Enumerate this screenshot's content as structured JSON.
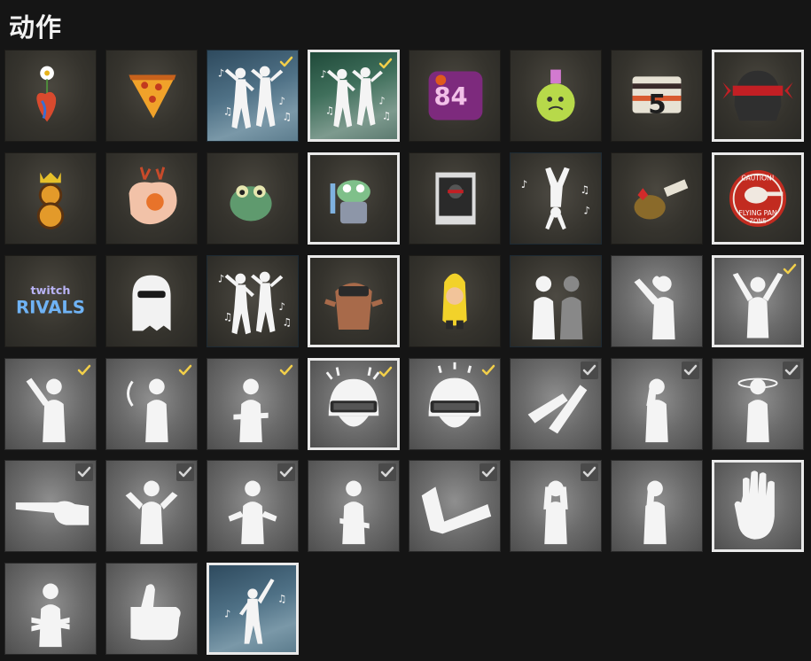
{
  "header": {
    "title": "动作"
  },
  "colors": {
    "check_gold": "#f2cf4a",
    "check_grey": "#d7d7d7",
    "selected_border": "#e9e9e9"
  },
  "rows": [
    [
      {
        "icon": "flower-heart-sticker-icon",
        "kind": "sticker",
        "selected": false,
        "check": ""
      },
      {
        "icon": "pizza-slice-sticker-icon",
        "kind": "sticker",
        "selected": false,
        "check": ""
      },
      {
        "icon": "dance-duo-emote-icon",
        "kind": "dance",
        "selected": false,
        "check": "gold"
      },
      {
        "icon": "dance-duo-emote-icon",
        "kind": "dance-green",
        "selected": true,
        "check": "gold"
      },
      {
        "icon": "graffiti-sticker-icon",
        "kind": "sticker",
        "selected": false,
        "check": ""
      },
      {
        "icon": "poison-potion-sticker-icon",
        "kind": "sticker",
        "selected": false,
        "check": ""
      },
      {
        "icon": "five-sticker-icon",
        "kind": "sticker",
        "selected": false,
        "check": ""
      },
      {
        "icon": "helmet-red-visor-sticker-icon",
        "kind": "sticker",
        "selected": true,
        "check": ""
      }
    ],
    [
      {
        "icon": "crowned-eight-sticker-icon",
        "kind": "sticker",
        "selected": false,
        "check": ""
      },
      {
        "icon": "reindeer-chicken-sticker-icon",
        "kind": "sticker",
        "selected": false,
        "check": ""
      },
      {
        "icon": "frog-sticker-icon",
        "kind": "sticker",
        "selected": false,
        "check": ""
      },
      {
        "icon": "frog-knight-sticker-icon",
        "kind": "sticker",
        "selected": true,
        "check": ""
      },
      {
        "icon": "wanted-poster-sticker-icon",
        "kind": "sticker",
        "selected": false,
        "check": ""
      },
      {
        "icon": "handstand-dance-emote-icon",
        "kind": "dance-dark",
        "selected": false,
        "check": ""
      },
      {
        "icon": "grenade-tag-sticker-icon",
        "kind": "sticker",
        "selected": false,
        "check": ""
      },
      {
        "icon": "flying-pan-zone-sticker-icon",
        "kind": "sticker",
        "selected": true,
        "check": ""
      }
    ],
    [
      {
        "icon": "twitch-rivals-sticker-icon",
        "kind": "sticker",
        "selected": false,
        "check": ""
      },
      {
        "icon": "ghost-sunglasses-sticker-icon",
        "kind": "sticker",
        "selected": false,
        "check": ""
      },
      {
        "icon": "dance-duo-emote-icon",
        "kind": "dance-dark",
        "selected": false,
        "check": ""
      },
      {
        "icon": "otter-vr-sticker-icon",
        "kind": "sticker",
        "selected": true,
        "check": ""
      },
      {
        "icon": "banana-character-sticker-icon",
        "kind": "sticker",
        "selected": false,
        "check": ""
      },
      {
        "icon": "push-duo-emote-icon",
        "kind": "dance-dark",
        "selected": false,
        "check": ""
      },
      {
        "icon": "heart-hands-emote-icon",
        "kind": "emote",
        "selected": false,
        "check": ""
      },
      {
        "icon": "surrender-emote-icon",
        "kind": "emote",
        "selected": true,
        "check": "gold"
      }
    ],
    [
      {
        "icon": "wave-emote-icon",
        "kind": "emote",
        "selected": false,
        "check": "gold"
      },
      {
        "icon": "head-turn-emote-icon",
        "kind": "emote",
        "selected": false,
        "check": "gold"
      },
      {
        "icon": "throat-cut-emote-icon",
        "kind": "emote",
        "selected": false,
        "check": "gold"
      },
      {
        "icon": "helmet-angry-emote-icon",
        "kind": "emote",
        "selected": true,
        "check": "gold"
      },
      {
        "icon": "helmet-laugh-emote-icon",
        "kind": "emote",
        "selected": false,
        "check": "gold"
      },
      {
        "icon": "clap-emote-icon",
        "kind": "emote",
        "selected": false,
        "check": "grey"
      },
      {
        "icon": "facepalm-emote-icon",
        "kind": "emote",
        "selected": false,
        "check": "grey"
      },
      {
        "icon": "dizzy-emote-icon",
        "kind": "emote",
        "selected": false,
        "check": "grey"
      }
    ],
    [
      {
        "icon": "point-emote-icon",
        "kind": "emote",
        "selected": false,
        "check": "grey"
      },
      {
        "icon": "shrug-emote-icon",
        "kind": "emote",
        "selected": false,
        "check": "grey"
      },
      {
        "icon": "confused-emote-icon",
        "kind": "emote",
        "selected": false,
        "check": "grey"
      },
      {
        "icon": "sulk-emote-icon",
        "kind": "emote",
        "selected": false,
        "check": "grey"
      },
      {
        "icon": "kick-emote-icon",
        "kind": "emote",
        "selected": false,
        "check": "grey"
      },
      {
        "icon": "scared-emote-icon",
        "kind": "emote",
        "selected": false,
        "check": "grey"
      },
      {
        "icon": "cry-emote-icon",
        "kind": "emote",
        "selected": false,
        "check": ""
      },
      {
        "icon": "stop-hand-emote-icon",
        "kind": "emote",
        "selected": true,
        "check": ""
      }
    ],
    [
      {
        "icon": "crossed-arms-emote-icon",
        "kind": "emote",
        "selected": false,
        "check": ""
      },
      {
        "icon": "thumbs-up-emote-icon",
        "kind": "emote",
        "selected": false,
        "check": ""
      },
      {
        "icon": "disco-point-emote-icon",
        "kind": "dance",
        "selected": true,
        "check": ""
      }
    ]
  ]
}
